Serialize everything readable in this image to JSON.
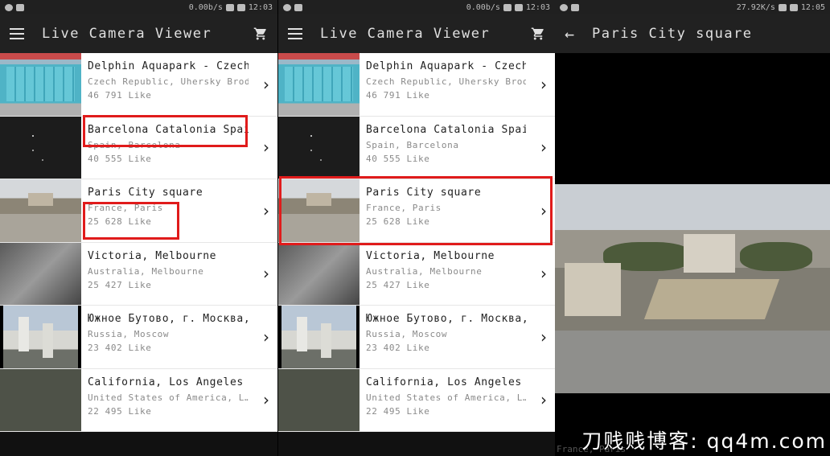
{
  "status_left": {
    "speed": "0.00b/s",
    "time": "12:03"
  },
  "status_mid": {
    "speed": "0.00b/s",
    "time": "12:03"
  },
  "status_right": {
    "speed": "27.92K/s",
    "time": "12:05"
  },
  "app": {
    "title": "Live Camera Viewer",
    "menu_icon": "menu-icon",
    "cart_icon": "cart-icon"
  },
  "detail": {
    "title": "Paris City square",
    "back_icon": "arrow-back-icon",
    "caption": "France, Paris"
  },
  "cameras": [
    {
      "name": "Delphin Aquapark  - Czech …",
      "location": "Czech Republic, Uhersky Brod",
      "likes": "46 791 Like"
    },
    {
      "name": "Barcelona Catalonia Spain",
      "location": "Spain, Barcelona",
      "likes": "40 555 Like"
    },
    {
      "name": "Paris City square",
      "location": "France, Paris",
      "likes": "25 628 Like"
    },
    {
      "name": "Victoria, Melbourne",
      "location": "Australia, Melbourne",
      "likes": "25 427 Like"
    },
    {
      "name": "Южное Бутово, г. Москва, …",
      "location": "Russia, Moscow",
      "likes": "23 402 Like"
    },
    {
      "name": "California, Los Angeles",
      "location": "United States of America, L…",
      "likes": "22 495 Like"
    }
  ],
  "watermark": "刀贱贱博客: qq4m.com",
  "colors": {
    "appbar": "#212121",
    "highlight": "#e01b1b"
  }
}
